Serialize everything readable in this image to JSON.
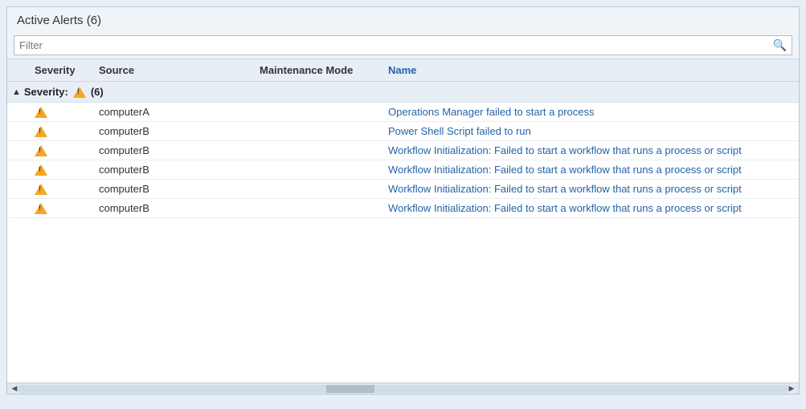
{
  "panel": {
    "title": "Active Alerts (6)",
    "filter_placeholder": "Filter",
    "columns": {
      "severity": "Severity",
      "source": "Source",
      "maintenance_mode": "Maintenance Mode",
      "name": "Name"
    },
    "group": {
      "label": "Severity:",
      "count": "(6)",
      "toggle": "▲"
    },
    "rows": [
      {
        "source": "computerA",
        "maintenance_mode": "",
        "name": "Operations Manager failed to start a process"
      },
      {
        "source": "computerB",
        "maintenance_mode": "",
        "name": "Power Shell Script failed to run"
      },
      {
        "source": "computerB",
        "maintenance_mode": "",
        "name": "Workflow Initialization: Failed to start a workflow that runs a process or script"
      },
      {
        "source": "computerB",
        "maintenance_mode": "",
        "name": "Workflow Initialization: Failed to start a workflow that runs a process or script"
      },
      {
        "source": "computerB",
        "maintenance_mode": "",
        "name": "Workflow Initialization: Failed to start a workflow that runs a process or script"
      },
      {
        "source": "computerB",
        "maintenance_mode": "",
        "name": "Workflow Initialization: Failed to start a workflow that runs a process or script"
      }
    ]
  }
}
